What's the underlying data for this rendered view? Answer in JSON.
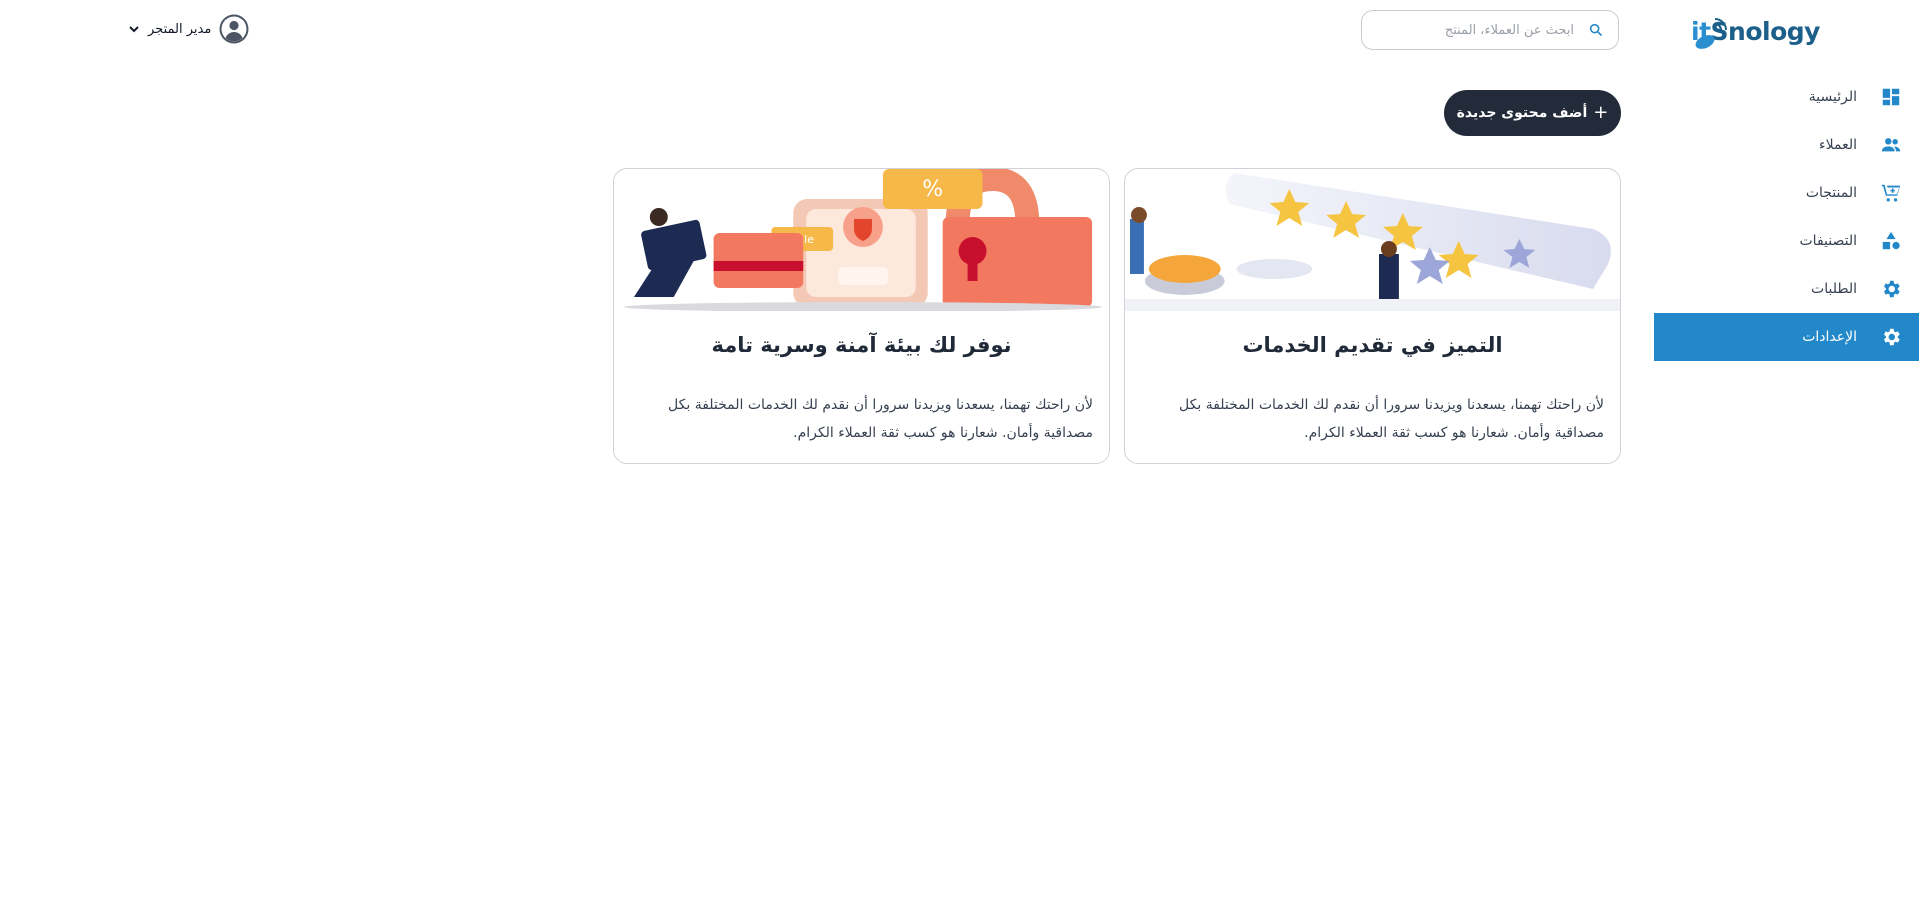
{
  "brand": {
    "logo_text_it": "it",
    "logo_text_rest": "Snology"
  },
  "sidebar": {
    "items": [
      {
        "label": "الرئيسية",
        "icon": "dashboard-icon",
        "active": false
      },
      {
        "label": "العملاء",
        "icon": "users-icon",
        "active": false
      },
      {
        "label": "المنتجات",
        "icon": "cart-icon",
        "active": false
      },
      {
        "label": "التصنيفات",
        "icon": "shapes-icon",
        "active": false
      },
      {
        "label": "الطلبات",
        "icon": "gear-icon",
        "active": false
      },
      {
        "label": "الإعدادات",
        "icon": "gear-icon",
        "active": true
      }
    ]
  },
  "header": {
    "search": {
      "placeholder": "ابحث عن العملاء، المنتج"
    },
    "user": {
      "name": "مدير المتجر"
    }
  },
  "main": {
    "add_button": {
      "plus": "+",
      "label": "أضف محتوى جديدة"
    },
    "cards": [
      {
        "title": "التميز في تقديم الخدمات",
        "description": "لأن راحتك تهمنا، يسعدنا ويزيدنا سرورا أن نقدم لك الخدمات المختلفة بكل مصداقية وأمان. شعارنا هو كسب ثقة العملاء الكرام.",
        "illustration": "stars-rating-illustration"
      },
      {
        "title": "نوفر لك بيئة آمنة وسرية تامة",
        "description": "لأن راحتك تهمنا، يسعدنا ويزيدنا سرورا أن نقدم لك الخدمات المختلفة بكل مصداقية وأمان. شعارنا هو كسب ثقة العملاء الكرام.",
        "illustration": "secure-lock-illustration",
        "illustration_texts": {
          "sale": "Sale",
          "percent": "%"
        }
      }
    ]
  },
  "colors": {
    "accent": "#2388c9",
    "button_dark": "#232b3b",
    "brand_dark": "#1c5f8a"
  }
}
